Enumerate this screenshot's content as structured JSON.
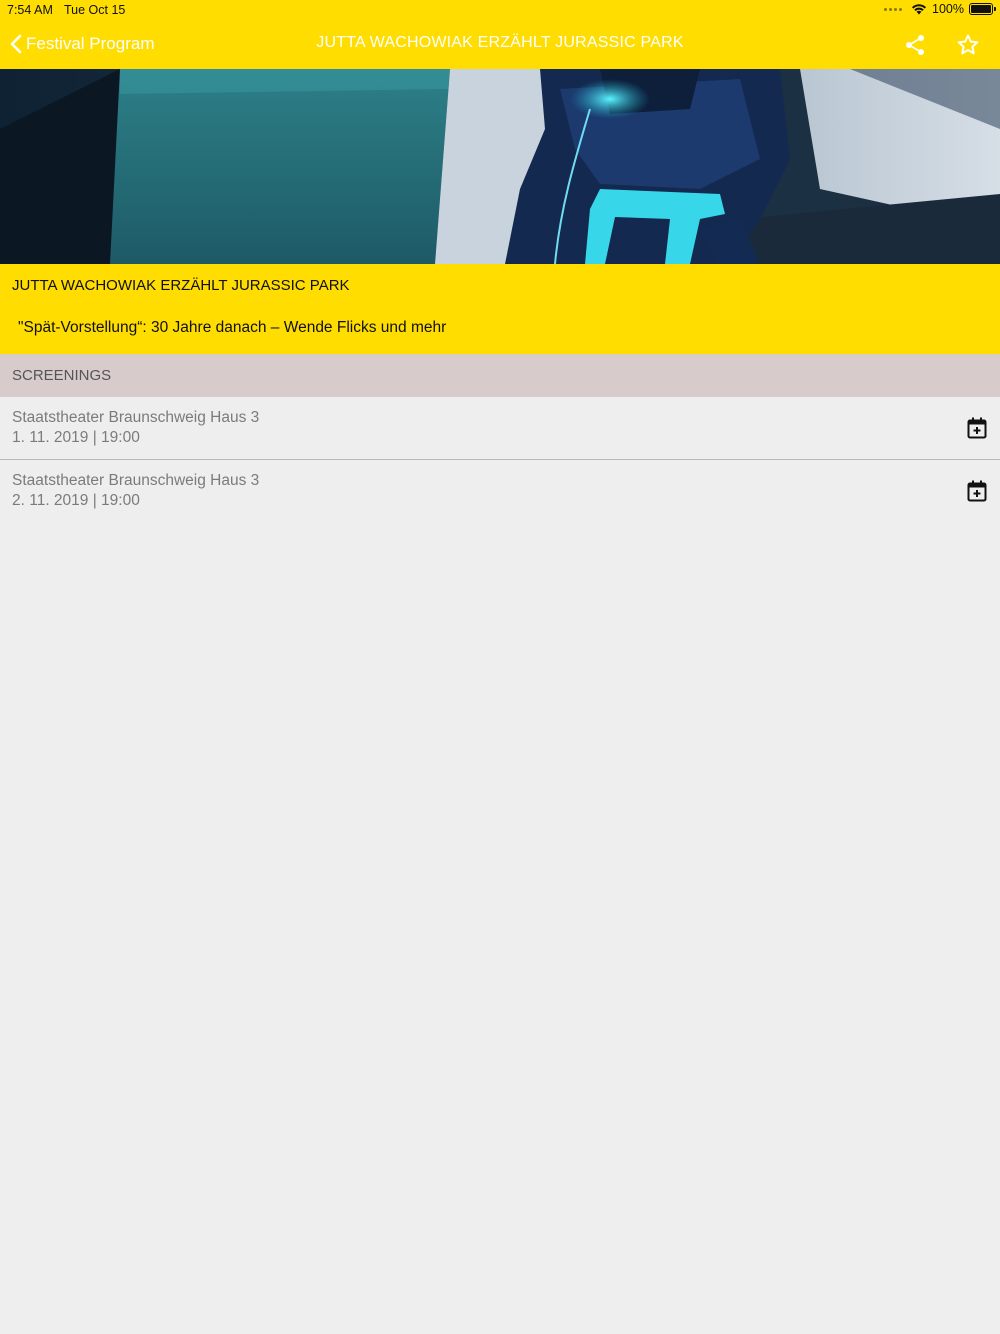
{
  "status": {
    "time": "7:54 AM",
    "date": "Tue Oct 15",
    "battery": "100%"
  },
  "nav": {
    "back_label": "Festival Program",
    "title": "JUTTA WACHOWIAK ERZÄHLT JURASSIC PARK",
    "share_icon": "share-icon",
    "favorite_icon": "star-outline-icon"
  },
  "event": {
    "title": "JUTTA WACHOWIAK ERZÄHLT JURASSIC PARK",
    "subtitle": "\"Spät-Vorstellung“: 30 Jahre danach – Wende Flicks und mehr"
  },
  "screenings": {
    "header": "SCREENINGS",
    "items": [
      {
        "venue": "Staatstheater Braunschweig Haus 3",
        "when": "1. 11. 2019 | 19:00",
        "icon": "calendar-add-icon"
      },
      {
        "venue": "Staatstheater Braunschweig Haus 3",
        "when": "2. 11. 2019 | 19:00",
        "icon": "calendar-add-icon"
      }
    ]
  },
  "colors": {
    "accent": "#ffdd00",
    "background": "#eeeeee",
    "section_header": "#d8cbcc"
  }
}
